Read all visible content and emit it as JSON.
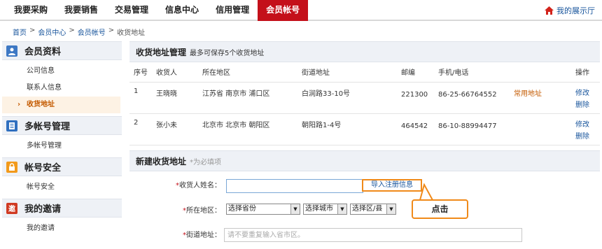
{
  "nav": {
    "tabs": [
      {
        "label": "我要采购"
      },
      {
        "label": "我要销售"
      },
      {
        "label": "交易管理"
      },
      {
        "label": "信息中心"
      },
      {
        "label": "信用管理"
      },
      {
        "label": "会员帐号",
        "active": true
      }
    ],
    "showroom_label": "我的展示厅",
    "accent_color": "#c4101a"
  },
  "breadcrumb": {
    "items": [
      "首页",
      "会员中心",
      "会员帐号"
    ],
    "current": "收货地址",
    "separator": ">"
  },
  "sidebar": {
    "groups": [
      {
        "title": "会员资料",
        "icon": "member-icon",
        "items": [
          {
            "label": "公司信息"
          },
          {
            "label": "联系人信息"
          },
          {
            "label": "收货地址",
            "active": true
          }
        ]
      },
      {
        "title": "多帐号管理",
        "icon": "document-icon",
        "items": [
          {
            "label": "多帐号管理"
          }
        ]
      },
      {
        "title": "帐号安全",
        "icon": "lock-icon",
        "items": [
          {
            "label": "帐号安全"
          }
        ]
      },
      {
        "title": "我的邀请",
        "icon": "invite-icon",
        "icon_text": "邀",
        "items": [
          {
            "label": "我的邀请"
          }
        ]
      }
    ]
  },
  "address_panel": {
    "title": "收货地址管理",
    "subtitle": "最多可保存5个收货地址",
    "columns": [
      "序号",
      "收货人",
      "所在地区",
      "街道地址",
      "邮编",
      "手机/电话",
      "",
      "操作"
    ],
    "rows": [
      {
        "no": "1",
        "name": "王晓晓",
        "region": "江苏省 南京市 浦口区",
        "street": "白润路33-10号",
        "zip": "221300",
        "phone": "86-25-66764552",
        "tag": "常用地址",
        "edit": "修改",
        "delete": "删除"
      },
      {
        "no": "2",
        "name": "张小未",
        "region": "北京市 北京市 朝阳区",
        "street": "朝阳路1-4号",
        "zip": "464542",
        "phone": "86-10-88994477",
        "tag": "",
        "edit": "修改",
        "delete": "删除"
      }
    ]
  },
  "new_address": {
    "title": "新建收货地址",
    "required_note": "*为必填项",
    "name_label": "收货人姓名：",
    "name_value": "",
    "import_label": "导入注册信息",
    "region_label": "所在地区：",
    "province": "选择省份",
    "city": "选择城市",
    "district": "选择区/县",
    "street_label": "街道地址：",
    "street_placeholder": "请不要重复输入省市区。",
    "required_mark": "*"
  },
  "callout": {
    "label": "点击"
  }
}
